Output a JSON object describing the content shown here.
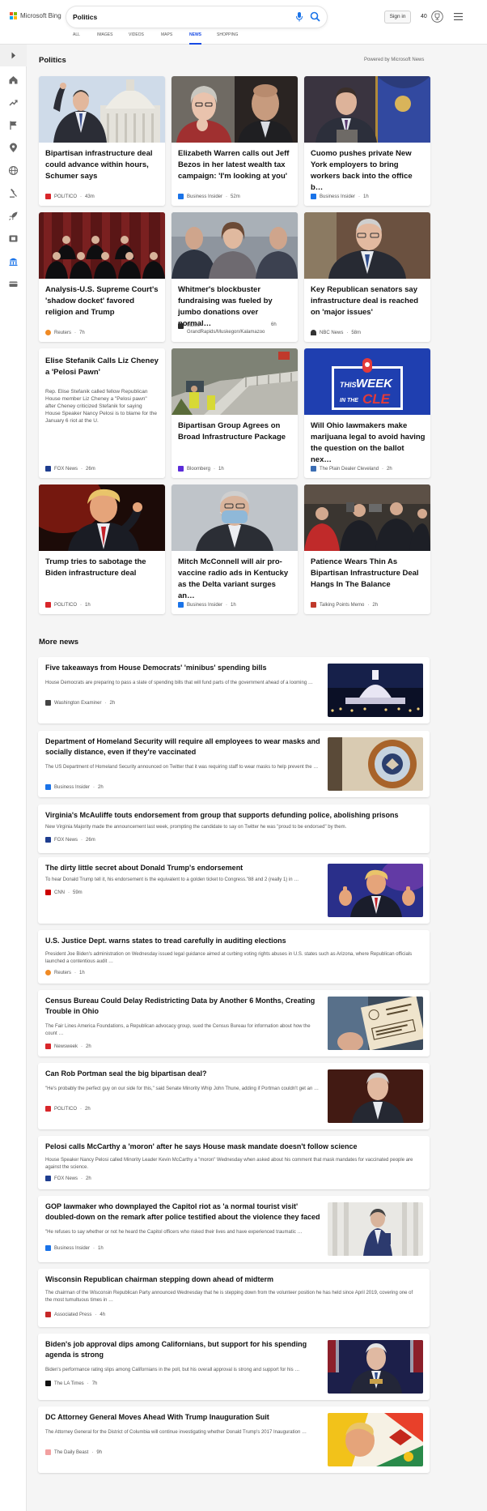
{
  "brand": {
    "logo_text": "Microsoft Bing",
    "colors": [
      "#f25022",
      "#7fba00",
      "#00a4ef",
      "#ffb900"
    ]
  },
  "search": {
    "query": "Politics"
  },
  "account": {
    "signin": "Sign in",
    "points": "40"
  },
  "nav_tabs": [
    "ALL",
    "IMAGES",
    "VIDEOS",
    "MAPS",
    "NEWS",
    "SHOPPING"
  ],
  "active_tab": "NEWS",
  "rail_icons": [
    "expand-arrow-icon",
    "home-icon",
    "trending-icon",
    "flag-icon",
    "location-icon",
    "globe-icon",
    "scales-icon",
    "rocket-icon",
    "film-icon",
    "capitol-icon",
    "money-icon"
  ],
  "politics": {
    "title": "Politics",
    "powered_by": "Powered by Microsoft News",
    "cards": [
      {
        "title": "Bipartisan infrastructure deal could advance within hours, Schumer says",
        "source": "POLITICO",
        "time": "43m",
        "logo_color": "#d8262a"
      },
      {
        "title": "Elizabeth Warren calls out Jeff Bezos in her latest wealth tax campaign: 'I'm looking at you'",
        "source": "Business Insider",
        "time": "52m",
        "logo_color": "#1a73e8"
      },
      {
        "title": "Cuomo pushes private New York employers to bring workers back into the office b…",
        "source": "Business Insider",
        "time": "1h",
        "logo_color": "#1a73e8"
      },
      {
        "title": "Analysis-U.S. Supreme Court's 'shadow docket' favored religion and Trump",
        "source": "Reuters",
        "time": "7h",
        "logo_color": "#f08a24"
      },
      {
        "title": "Whitmer's blockbuster fundraising was fueled by jumbo donations over normal…",
        "source": "MLive - GrandRapids/Muskegon/Kalamazoo",
        "time": "6h",
        "logo_color": "#2b2b2b"
      },
      {
        "title": "Key Republican senators say infrastructure deal is reached on 'major issues'",
        "source": "NBC News",
        "time": "58m",
        "logo_color": "#333333"
      },
      {
        "title": "Elise Stefanik Calls Liz Cheney a 'Pelosi Pawn'",
        "desc": "Rep. Elise Stefanik called fellow Republican House member Liz Cheney a \"Pelosi pawn\" after Cheney criticized Stefanik for saying House Speaker Nancy Pelosi is to blame for the January 6 riot at the U.",
        "source": "FOX News",
        "time": "26m",
        "logo_color": "#1e3d8f"
      },
      {
        "title": "Bipartisan Group Agrees on Broad Infrastructure Package",
        "source": "Bloomberg",
        "time": "1h",
        "logo_color": "#5b2bd9"
      },
      {
        "title": "Will Ohio lawmakers make marijuana legal to avoid having the question on the ballot nex…",
        "source": "The Plain Dealer Cleveland",
        "time": "2h",
        "logo_color": "#3b6db3"
      },
      {
        "title": "Trump tries to sabotage the Biden infrastructure deal",
        "source": "POLITICO",
        "time": "1h",
        "logo_color": "#d8262a"
      },
      {
        "title": "Mitch McConnell will air pro-vaccine radio ads in Kentucky as the Delta variant surges an…",
        "source": "Business Insider",
        "time": "1h",
        "logo_color": "#1a73e8"
      },
      {
        "title": "Patience Wears Thin As Bipartisan Infrastructure Deal Hangs In The Balance",
        "source": "Talking Points Memo",
        "time": "2h",
        "logo_color": "#c0392b"
      }
    ],
    "cle_badge": {
      "line1": "THIS",
      "line2": "WEEK",
      "line3": "IN THE",
      "line4": "CLE"
    }
  },
  "more_news": {
    "title": "More news",
    "items": [
      {
        "title": "Five takeaways from House Democrats' 'minibus' spending bills",
        "desc": "House Democrats are preparing to pass a slate of spending bills that will fund parts of the government ahead of a looming …",
        "source": "Washington Examiner",
        "time": "2h",
        "logo_color": "#444444"
      },
      {
        "title": "Department of Homeland Security will require all employees to wear masks and socially distance, even if they're vaccinated",
        "desc": "The US Department of Homeland Security announced on Twitter that it was requiring staff to wear masks to help prevent the …",
        "source": "Business Insider",
        "time": "2h",
        "logo_color": "#1a73e8"
      },
      {
        "title": "Virginia's McAuliffe touts endorsement from group that supports defunding police, abolishing prisons",
        "desc": "New Virginia Majority made the announcement last week, prompting the candidate to say on Twitter he was \"proud to be endorsed\" by them.",
        "source": "FOX News",
        "time": "26m",
        "logo_color": "#1e3d8f"
      },
      {
        "title": "The dirty little secret about Donald Trump's endorsement",
        "desc": "To hear Donald Trump tell it, his endorsement is the equivalent to a golden ticket to Congress.\"88 and 2 (really 1) in …",
        "source": "CNN",
        "time": "59m",
        "logo_color": "#cc0000"
      },
      {
        "title": "U.S. Justice Dept. warns states to tread carefully in auditing elections",
        "desc": "President Joe Biden's administration on Wednesday issued legal guidance aimed at curbing voting rights abuses in U.S. states such as Arizona, where Republican officials launched a contentious audit …",
        "source": "Reuters",
        "time": "1h",
        "logo_color": "#f08a24"
      },
      {
        "title": "Census Bureau Could Delay Redistricting Data by Another 6 Months, Creating Trouble in Ohio",
        "desc": "The Fair Lines America Foundations, a Republican advocacy group, sued the Census Bureau for information about how the count …",
        "source": "Newsweek",
        "time": "2h",
        "logo_color": "#d8262a"
      },
      {
        "title": "Can Rob Portman seal the big bipartisan deal?",
        "desc": "\"He's probably the perfect guy on our side for this,\" said Senate Minority Whip John Thune, adding if Portman couldn't get an …",
        "source": "POLITICO",
        "time": "2h",
        "logo_color": "#d8262a"
      },
      {
        "title": "Pelosi calls McCarthy a 'moron' after he says House mask mandate doesn't follow science",
        "desc": "House Speaker Nancy Pelosi called Minority Leader Kevin McCarthy a \"moron\" Wednesday when asked about his comment that mask mandates for vaccinated people are against the science.",
        "source": "FOX News",
        "time": "2h",
        "logo_color": "#1e3d8f"
      },
      {
        "title": "GOP lawmaker who downplayed the Capitol riot as 'a normal tourist visit' doubled-down on the remark after police testified about the violence they faced",
        "desc": "\"He refuses to say whether or not he heard the Capitol officers who risked their lives and have experienced traumatic …",
        "source": "Business Insider",
        "time": "1h",
        "logo_color": "#1a73e8"
      },
      {
        "title": "Wisconsin Republican chairman stepping down ahead of midterm",
        "desc": "The chairman of the Wisconsin Republican Party announced Wednesday that he is stepping down from the volunteer position he has held since April 2019, covering one of the most tumultuous times in …",
        "source": "Associated Press",
        "time": "4h",
        "logo_color": "#c62828"
      },
      {
        "title": "Biden's job approval dips among Californians, but support for his spending agenda is strong",
        "desc": "Biden's performance rating slips among Californians in the poll, but his overall approval is strong and support for his …",
        "source": "The LA Times",
        "time": "7h",
        "logo_color": "#111111"
      },
      {
        "title": "DC Attorney General Moves Ahead With Trump Inauguration Suit",
        "desc": "The Attorney General for the District of Columbia will continue investigating whether Donald Trump's 2017 Inauguration …",
        "source": "The Daily Beast",
        "time": "9h",
        "logo_color": "#f2a0a0"
      }
    ]
  }
}
